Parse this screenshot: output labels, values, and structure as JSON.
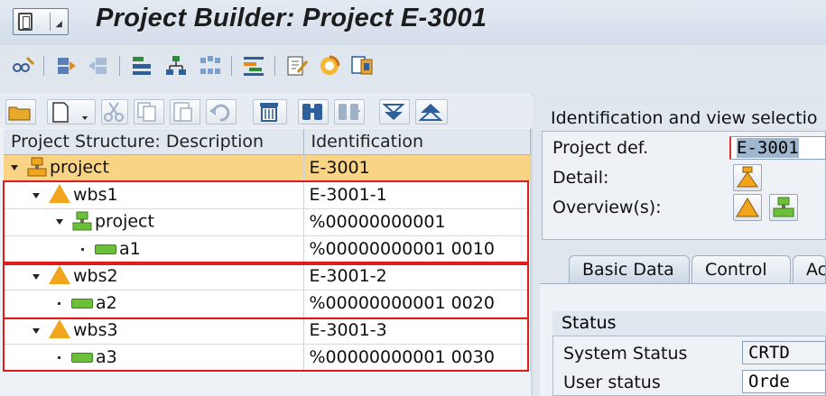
{
  "title": "Project Builder: Project E-3001",
  "tree": {
    "col_desc": "Project Structure: Description",
    "col_id": "Identification",
    "rows": [
      {
        "desc": "project",
        "id": "E-3001"
      },
      {
        "desc": "wbs1",
        "id": "E-3001-1"
      },
      {
        "desc": "project",
        "id": "%00000000001"
      },
      {
        "desc": "a1",
        "id": "%00000000001 0010"
      },
      {
        "desc": "wbs2",
        "id": "E-3001-2"
      },
      {
        "desc": "a2",
        "id": "%00000000001 0020"
      },
      {
        "desc": "wbs3",
        "id": "E-3001-3"
      },
      {
        "desc": "a3",
        "id": "%00000000001 0030"
      }
    ]
  },
  "ident": {
    "group_title": "Identification and view selectio",
    "project_def_label": "Project def.",
    "project_def_value": "E-3001",
    "detail_label": "Detail:",
    "overview_label": "Overview(s):"
  },
  "tabs": [
    "Basic Data",
    "Control",
    "Ac"
  ],
  "status": {
    "group_title": "Status",
    "system_label": "System Status",
    "system_value": "CRTD",
    "user_label": "User status",
    "user_value": "Orde"
  },
  "colors": {
    "selected_row": "#f9d484",
    "highlight_box": "#e11a1a",
    "wbs_icon": "#f1a51d",
    "activity_icon": "#6cbf3a"
  }
}
